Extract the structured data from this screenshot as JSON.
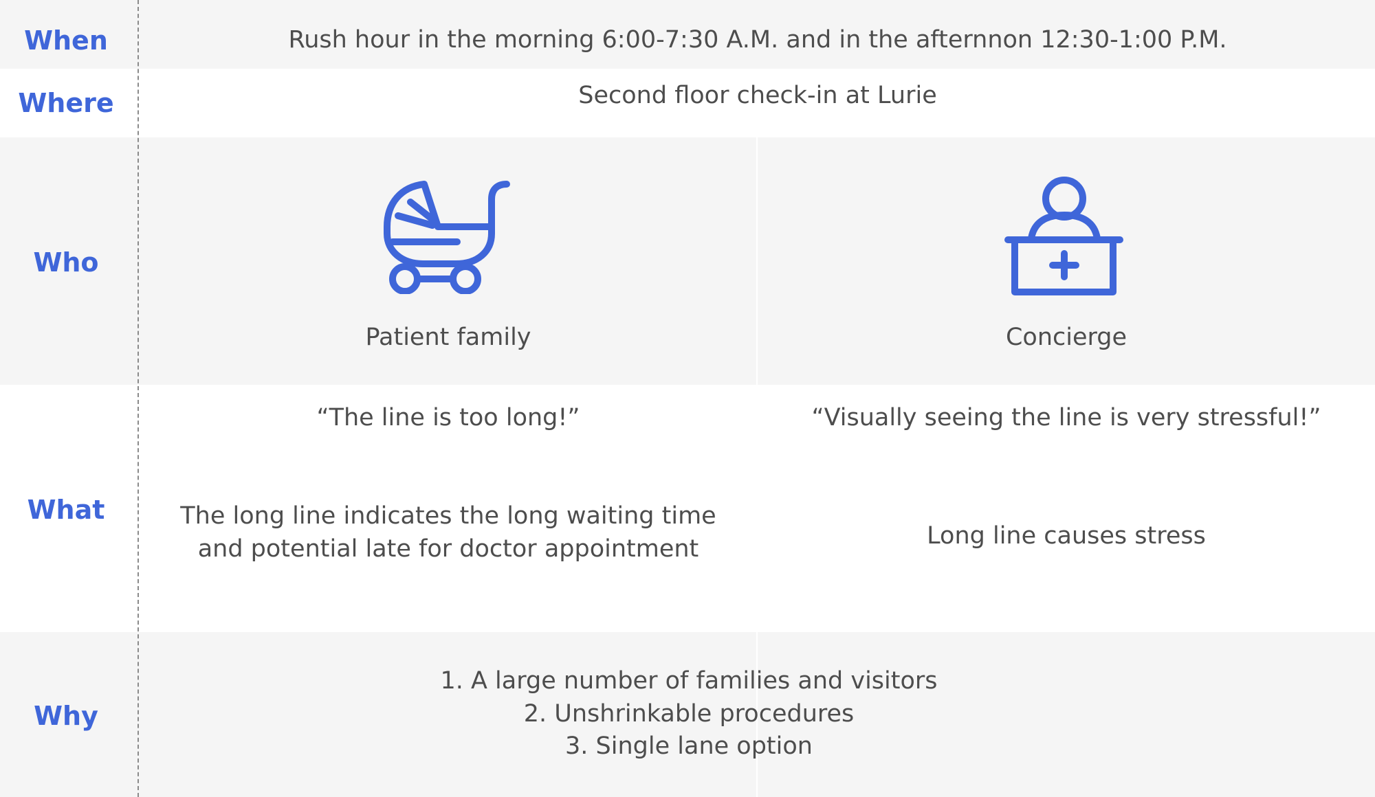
{
  "accent_color": "#3f66d9",
  "text_color": "#4d4d4d",
  "rows": {
    "when": {
      "label": "When",
      "text": "Rush hour in the morning 6:00-7:30 A.M. and in the afternnon 12:30-1:00 P.M."
    },
    "where": {
      "label": "Where",
      "text": "Second floor check-in at Lurie"
    },
    "who": {
      "label": "Who",
      "left": {
        "icon": "stroller-icon",
        "name": "Patient family"
      },
      "right": {
        "icon": "concierge-desk-icon",
        "name": "Concierge"
      }
    },
    "what": {
      "label": "What",
      "left_quote": "“The line is too long!”",
      "left_desc_line1": "The long line indicates the long waiting time",
      "left_desc_line2": "and potential late for doctor appointment",
      "right_quote": "“Visually seeing the line is very stressful!”",
      "right_desc": "Long line causes stress"
    },
    "why": {
      "label": "Why",
      "items": [
        "1. A large number of families and visitors",
        "2. Unshrinkable procedures",
        "3. Single lane option"
      ]
    }
  }
}
